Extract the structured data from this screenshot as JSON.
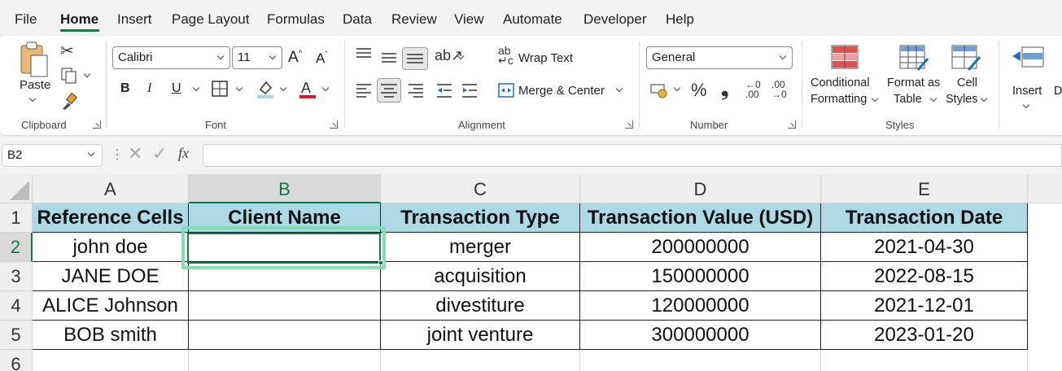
{
  "menu": {
    "items": [
      "File",
      "Home",
      "Insert",
      "Page Layout",
      "Formulas",
      "Data",
      "Review",
      "View",
      "Automate",
      "Developer",
      "Help"
    ],
    "active": "Home"
  },
  "ribbon": {
    "clipboard": {
      "paste_label": "Paste",
      "group_label": "Clipboard"
    },
    "font": {
      "font_name": "Calibri",
      "font_size": "11",
      "bold": "B",
      "italic": "I",
      "underline": "U",
      "group_label": "Font",
      "highlight_color": "#ffff00",
      "font_color": "#e81123"
    },
    "alignment": {
      "wrap_text": "Wrap Text",
      "merge_center": "Merge & Center",
      "group_label": "Alignment"
    },
    "number": {
      "format": "General",
      "percent": "%",
      "comma": "❟",
      "group_label": "Number"
    },
    "styles": {
      "conditional_formatting": [
        "Conditional",
        "Formatting"
      ],
      "format_as_table": [
        "Format as",
        "Table"
      ],
      "cell_styles": [
        "Cell",
        "Styles"
      ],
      "group_label": "Styles"
    },
    "cells": {
      "insert": "Insert",
      "delete_partial": "D"
    }
  },
  "formula_bar": {
    "name_box": "B2",
    "fx": "fx",
    "formula": ""
  },
  "sheet": {
    "columns": [
      "A",
      "B",
      "C",
      "D",
      "E"
    ],
    "rows": [
      "1",
      "2",
      "3",
      "4",
      "5",
      "6"
    ],
    "selected_cell": "B2",
    "header_fill": "#add8e6",
    "data": [
      [
        "Reference Cells",
        "Client Name",
        "Transaction Type",
        "Transaction Value (USD)",
        "Transaction Date"
      ],
      [
        "john doe",
        "",
        "merger",
        "200000000",
        "2021-04-30"
      ],
      [
        "JANE DOE",
        "",
        "acquisition",
        "150000000",
        "2022-08-15"
      ],
      [
        "ALICE Johnson",
        "",
        "divestiture",
        "120000000",
        "2021-12-01"
      ],
      [
        "BOB smith",
        "",
        "joint venture",
        "300000000",
        "2023-01-20"
      ]
    ]
  }
}
